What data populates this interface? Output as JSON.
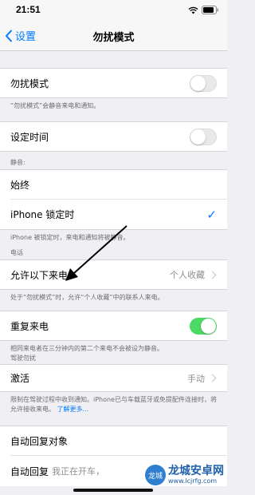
{
  "status_bar": {
    "time": "21:51"
  },
  "nav": {
    "back_label": "设置",
    "title": "勿扰模式"
  },
  "dnd": {
    "label": "勿扰模式",
    "on": false,
    "footnote": "“勿扰模式”会静音来电和通知。"
  },
  "scheduled": {
    "label": "设定时间",
    "on": false
  },
  "silence": {
    "header": "静音:",
    "always": "始终",
    "locked": "iPhone 锁定时",
    "footnote": "iPhone 被锁定时，来电和通知将被静音。"
  },
  "phone": {
    "header": "电话",
    "allow_calls_label": "允许以下来电",
    "allow_calls_value": "个人收藏",
    "allow_calls_footnote": "处于“勿扰模式”时，允许“个人收藏”中的联系人来电。",
    "repeated_label": "重复来电",
    "repeated_on": true,
    "repeated_footnote": "相同来电者在三分钟内的第二个来电不会被设为静音。"
  },
  "driving": {
    "header": "驾驶勿扰",
    "activate_label": "激活",
    "activate_value": "手动",
    "footnote": "限制在驾驶过程中收到通知。iPhone已与车载蓝牙或免提配件连接时，将允许接收来电。",
    "learn_more": "了解更多..."
  },
  "auto_reply_to": {
    "label": "自动回复对象"
  },
  "auto_reply": {
    "label": "自动回复",
    "value": "我正在开车，"
  },
  "watermark": {
    "logo": "龙城",
    "title": "龙城安卓网",
    "url": "www.lcjrfg.com"
  },
  "colors": {
    "accent": "#007aff",
    "toggle_on": "#4cd964"
  }
}
